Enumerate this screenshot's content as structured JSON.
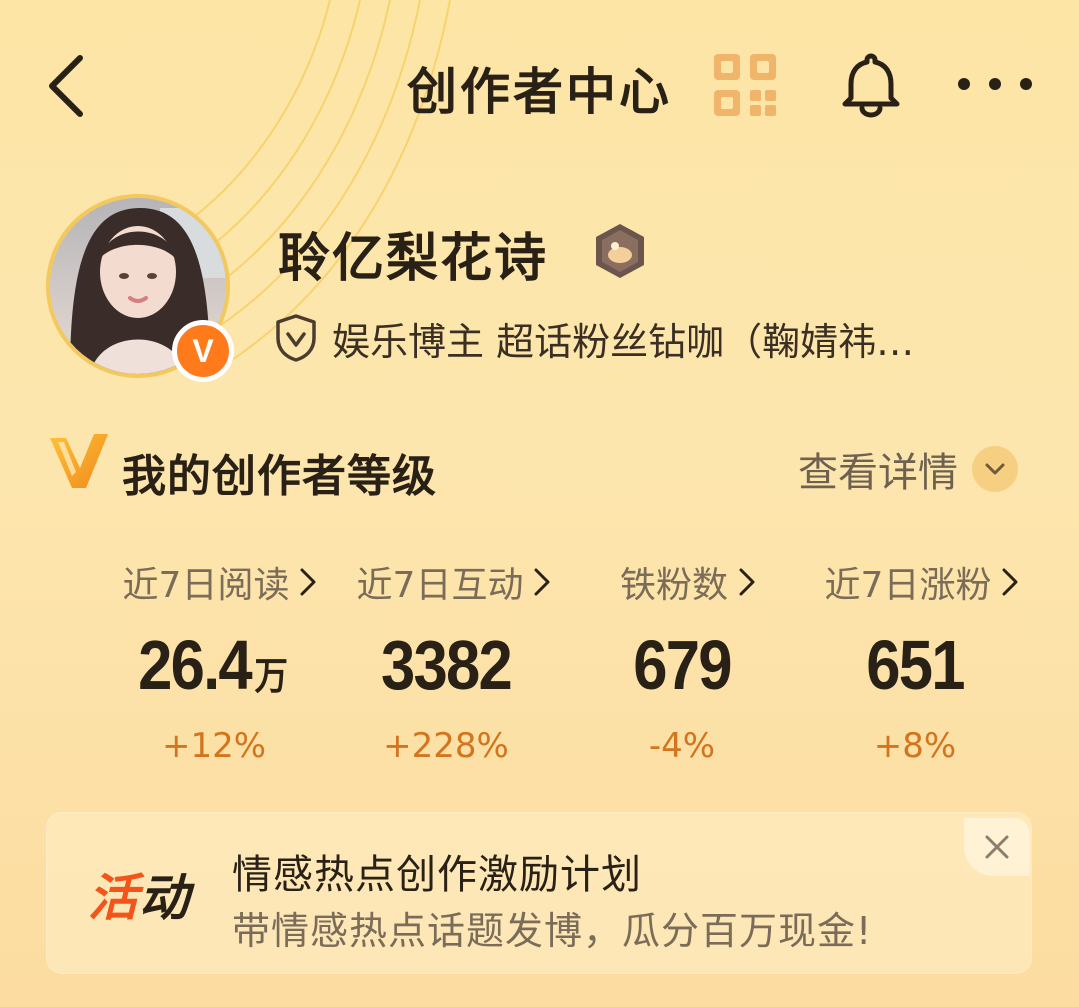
{
  "header": {
    "title": "创作者中心",
    "icons": [
      "back-icon",
      "qr-code-icon",
      "bell-icon",
      "more-icon"
    ]
  },
  "profile": {
    "username": "聆亿梨花诗",
    "avatar_badge": "V",
    "verification": "娱乐博主 超话粉丝钻咖（鞠婧祎…"
  },
  "level": {
    "title": "我的创作者等级",
    "detail_label": "查看详情"
  },
  "stats": [
    {
      "label": "近7日阅读",
      "value": "26.4",
      "unit": "万",
      "change": "+12%"
    },
    {
      "label": "近7日互动",
      "value": "3382",
      "unit": "",
      "change": "+228%"
    },
    {
      "label": "铁粉数",
      "value": "679",
      "unit": "",
      "change": "-4%"
    },
    {
      "label": "近7日涨粉",
      "value": "651",
      "unit": "",
      "change": "+8%"
    }
  ],
  "activity": {
    "tag_part1": "活",
    "tag_part2": "动",
    "title": "情感热点创作激励计划",
    "subtitle": "带情感热点话题发博，瓜分百万现金!"
  },
  "colors": {
    "background": "#fde5a6",
    "accent_orange": "#f2541a",
    "change_text": "#d2751e",
    "primary_text": "#2a2116"
  }
}
